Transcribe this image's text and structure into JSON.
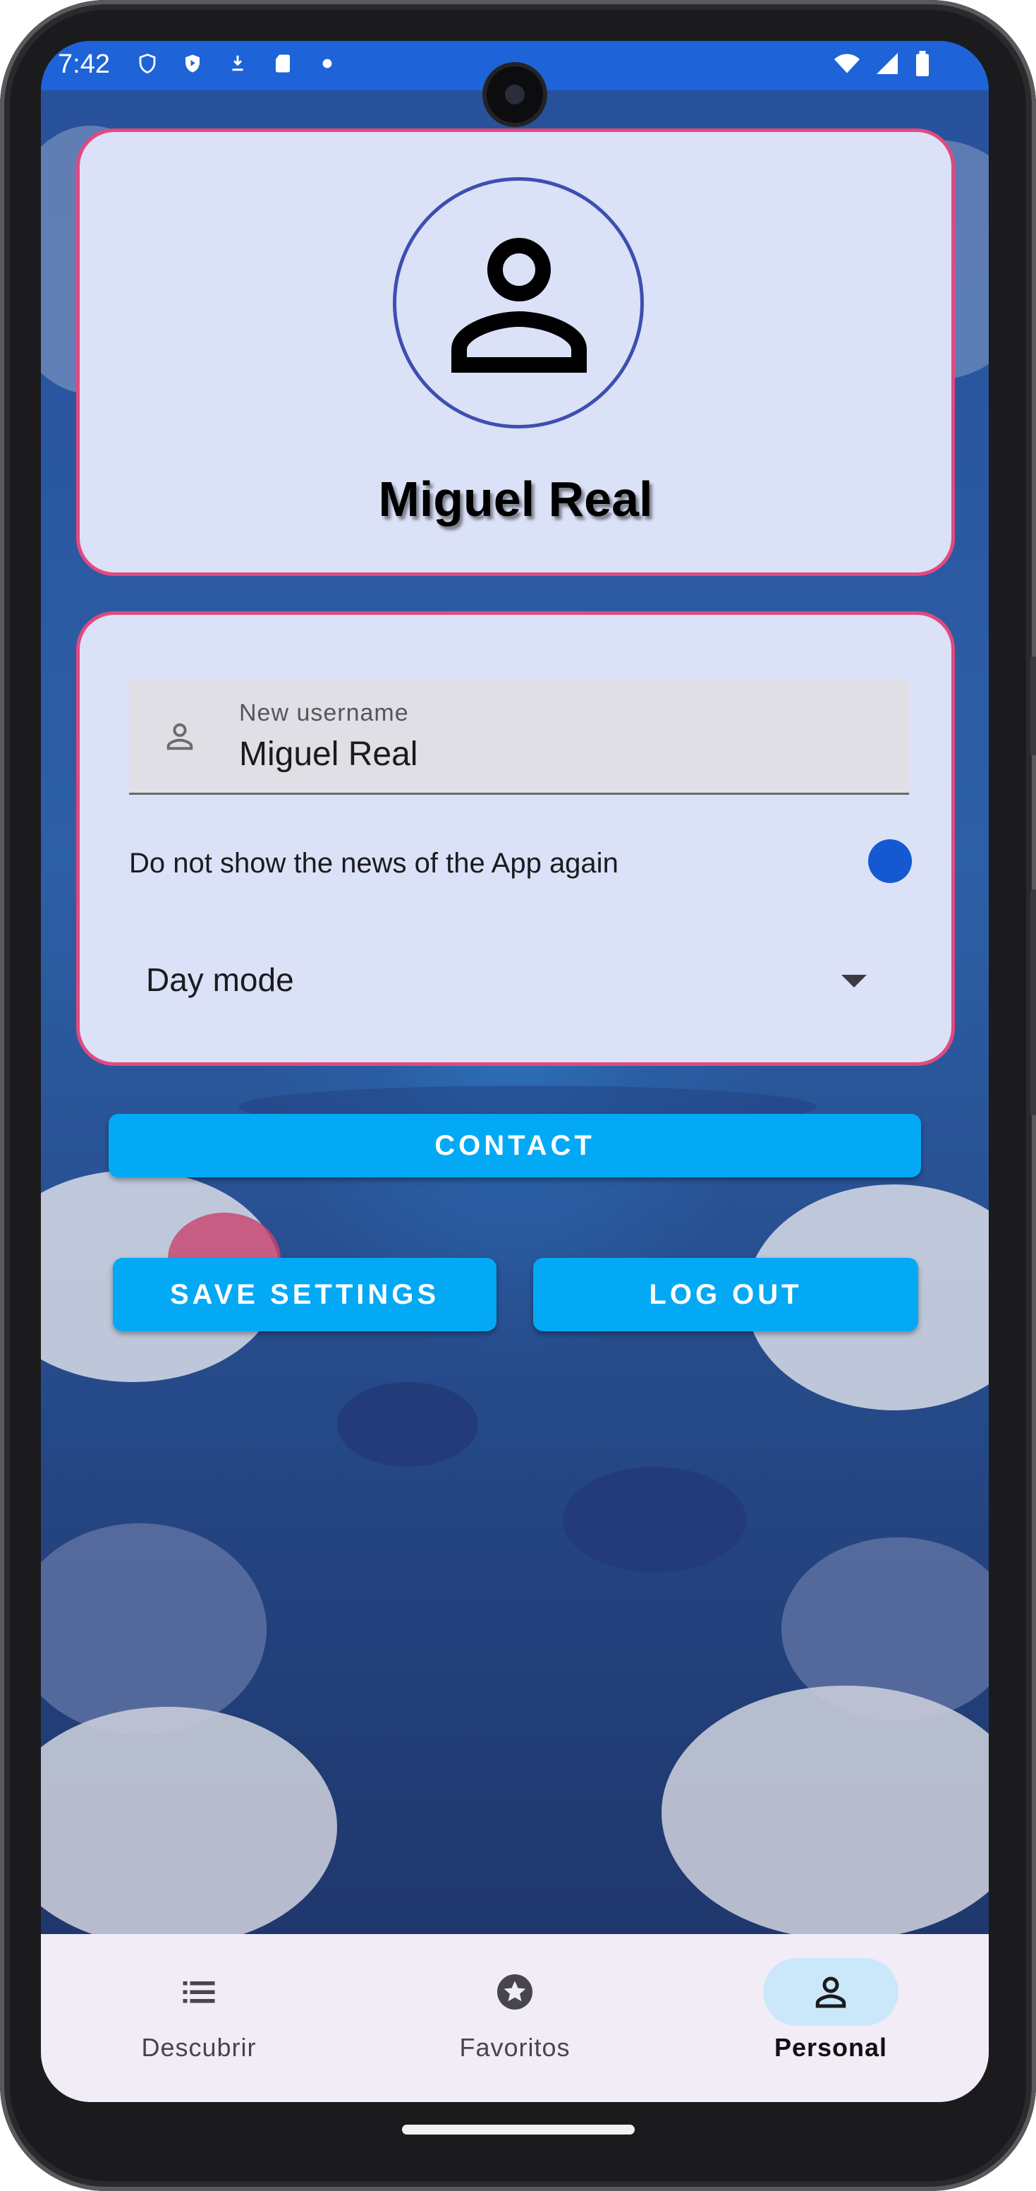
{
  "status_bar": {
    "time": "7:42",
    "icons": [
      "shield-icon",
      "play-protect-icon",
      "download-icon",
      "sd-card-icon",
      "dot-icon",
      "wifi-icon",
      "signal-icon",
      "battery-icon"
    ]
  },
  "profile": {
    "name": "Miguel Real",
    "avatar_icon": "person-icon"
  },
  "settings": {
    "username_label": "New username",
    "username_value": "Miguel Real",
    "hide_news_label": "Do not show the news of the App again",
    "hide_news_enabled": true,
    "theme_selected": "Day mode"
  },
  "buttons": {
    "contact": "CONTACT",
    "save": "SAVE SETTINGS",
    "logout": "LOG OUT"
  },
  "nav": {
    "items": [
      {
        "label": "Descubrir",
        "icon": "list-icon"
      },
      {
        "label": "Favoritos",
        "icon": "star-icon"
      },
      {
        "label": "Personal",
        "icon": "person-icon"
      }
    ],
    "active": "Personal"
  },
  "colors": {
    "accent_button": "#03a9f4",
    "card_border": "#e2497f",
    "card_bg": "#dbe1f7",
    "status_bar": "#1e63d8",
    "toggle": "#1459d2"
  }
}
